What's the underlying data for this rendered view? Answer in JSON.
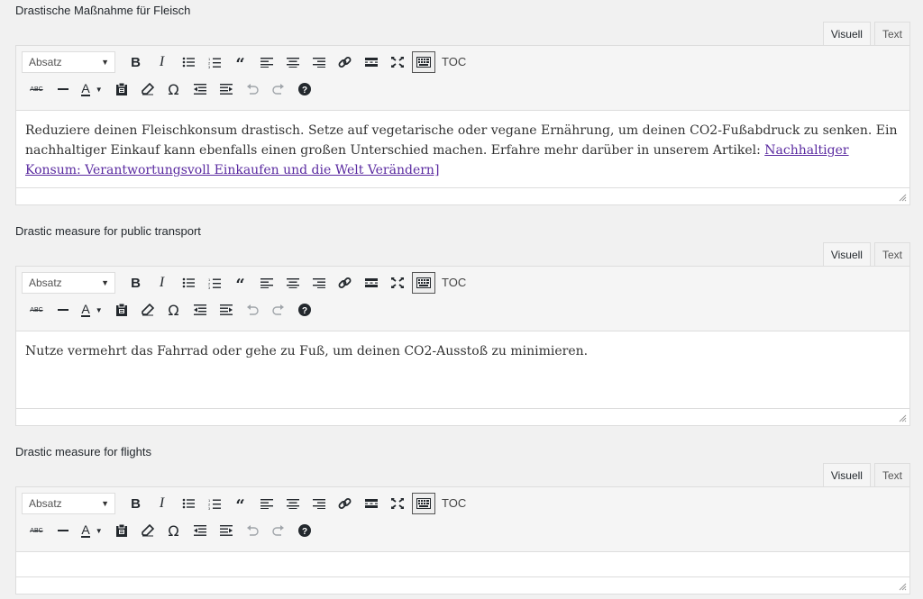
{
  "tabs": {
    "visual": "Visuell",
    "text": "Text"
  },
  "toolbar": {
    "format": "Absatz",
    "toc": "TOC"
  },
  "fields": [
    {
      "label": "Drastische Maßnahme für Fleisch",
      "text": "Reduziere deinen Fleischkonsum drastisch. Setze auf vegetarische oder vegane Ernährung, um deinen CO2-Fußabdruck zu senken. Ein nachhaltiger Einkauf kann ebenfalls einen großen Unterschied machen. Erfahre mehr darüber in unserem Artikel: ",
      "link": "Nachhaltiger Konsum: Verantwortungsvoll Einkaufen und die Welt Verändern]"
    },
    {
      "label": "Drastic measure for public transport",
      "text": "Nutze vermehrt das Fahrrad oder gehe zu Fuß, um deinen CO2-Ausstoß zu minimieren.",
      "link": ""
    },
    {
      "label": "Drastic measure for flights",
      "text": "",
      "link": ""
    }
  ]
}
